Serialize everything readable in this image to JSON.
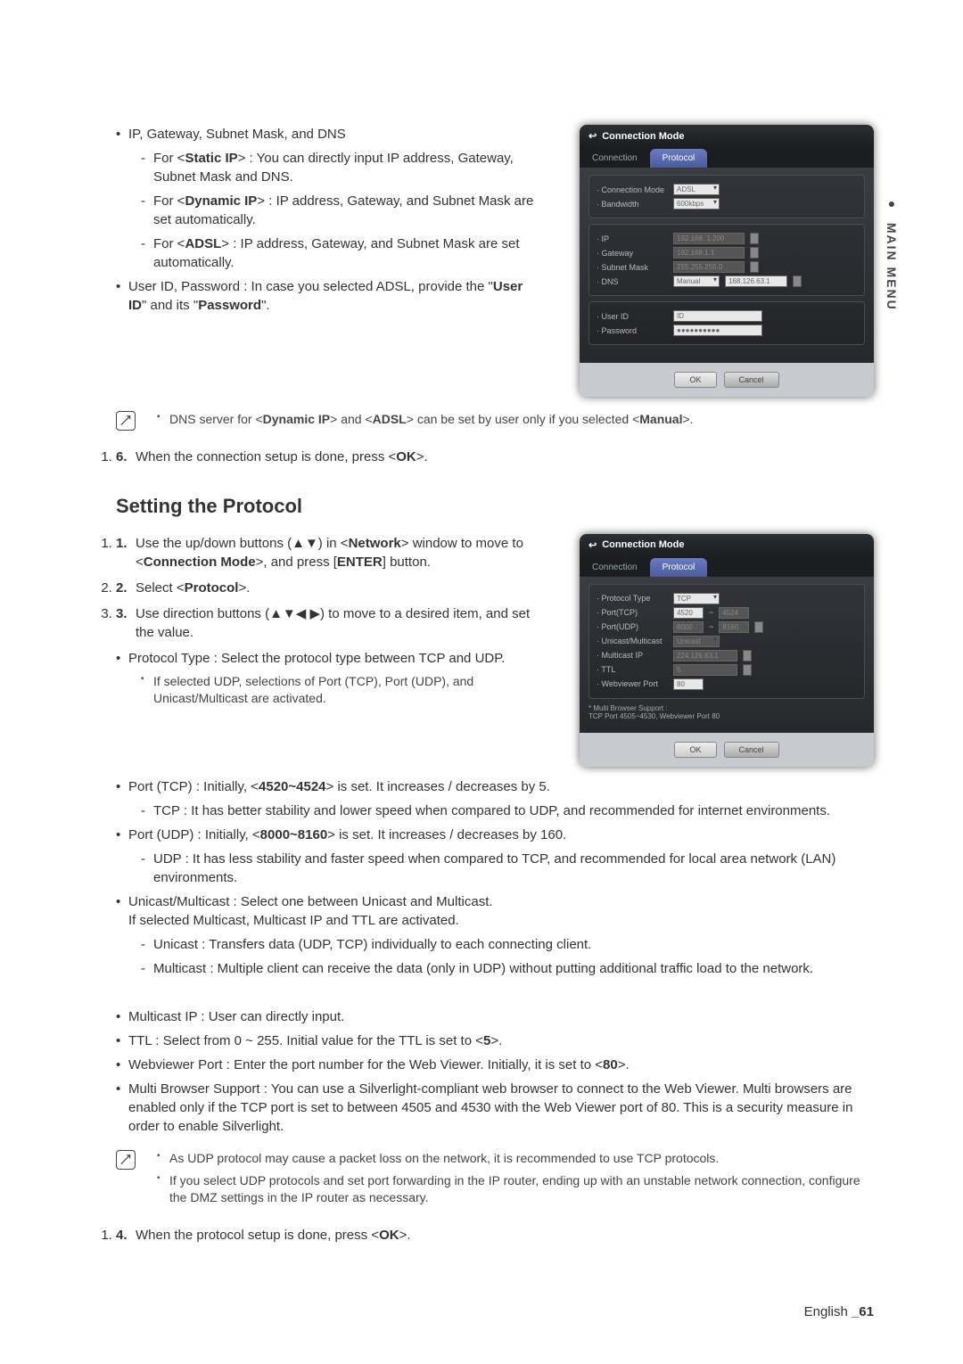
{
  "side_tab": "MAIN MENU",
  "sec1": {
    "b1": "IP, Gateway, Subnet Mask, and DNS",
    "d1": "For <Static IP> : You can directly input IP address, Gateway, Subnet Mask and DNS.",
    "d2": "For <Dynamic IP> : IP address, Gateway, and Subnet Mask are set automatically.",
    "d3": "For <ADSL> : IP address, Gateway, and Subnet Mask are set automatically.",
    "b2": "User ID, Password : In case you selected ADSL, provide the \"User ID\" and its \"Password\".",
    "note": "DNS server for <Dynamic IP> and <ADSL> can be set by user only if you selected <Manual>.",
    "step6": "When the connection setup is done, press <OK>."
  },
  "section_heading": "Setting the Protocol",
  "sec2": {
    "step1": "Use the up/down buttons (▲▼) in <Network> window to move to <Connection Mode>, and press [ENTER] button.",
    "step2": "Select <Protocol>.",
    "step3": "Use direction buttons (▲▼◀ ▶) to move to a desired item, and set the value.",
    "b_type": "Protocol Type : Select the protocol type between TCP and UDP.",
    "sq_udp": "If selected UDP, selections of Port (TCP), Port (UDP), and Unicast/Multicast are activated.",
    "b_tcp": "Port (TCP) : Initially, <4520~4524> is set. It increases / decreases by 5.",
    "d_tcp": "TCP : It has better stability and lower speed when compared to UDP, and recommended for internet environments.",
    "b_udp": "Port (UDP) : Initially, <8000~8160> is set. It increases / decreases by 160.",
    "d_udp": "UDP : It has less stability and faster speed when compared to TCP, and recommended for local area network (LAN) environments.",
    "b_uni": "Unicast/Multicast : Select one between Unicast and Multicast.\nIf selected Multicast, Multicast IP and TTL are activated.",
    "d_uni": "Unicast : Transfers data (UDP, TCP) individually to each connecting client.",
    "d_multi": "Multicast : Multiple client can receive the data (only in UDP) without putting additional traffic load to the network.",
    "b_mip": "Multicast IP : User can directly input.",
    "b_ttl": "TTL : Select from 0 ~ 255. Initial value for the TTL is set to <5>.",
    "b_web": "Webviewer Port : Enter the port number for the Web Viewer. Initially, it is set to <80>.",
    "b_multi": "Multi Browser Support : You can use a Silverlight-compliant web browser to connect to the Web Viewer. Multi browsers are enabled only if the TCP port is set to between 4505 and 4530 with the Web Viewer port of 80. This is a security measure in order to enable Silverlight.",
    "note1": "As UDP protocol may cause a packet loss on the network, it is recommended to use TCP protocols.",
    "note2": "If you select UDP protocols and set port forwarding in the IP router, ending up with an unstable network connection, configure the DMZ settings in the IP router as necessary.",
    "step4": "When the protocol setup is done, press <OK>."
  },
  "dialog1": {
    "title": "Connection Mode",
    "tab1": "Connection",
    "tab2": "Protocol",
    "cm_label": "· Connection Mode",
    "cm_val": "ADSL",
    "bw_label": "· Bandwidth",
    "bw_val": "600kbps",
    "ip_label": "· IP",
    "ip_val": "192.168. 1.200",
    "gw_label": "· Gateway",
    "gw_val": "192.168.1.1",
    "sm_label": "· Subnet Mask",
    "sm_val": "255.255.255.0",
    "dns_label": "· DNS",
    "dns_mode": "Manual",
    "dns_val": "168.126.63.1",
    "uid_label": "· User ID",
    "uid_val": "ID",
    "pw_label": "· Password",
    "pw_val": "●●●●●●●●●●",
    "ok": "OK",
    "cancel": "Cancel"
  },
  "dialog2": {
    "title": "Connection Mode",
    "tab1": "Connection",
    "tab2": "Protocol",
    "pt_label": "· Protocol Type",
    "pt_val": "TCP",
    "ptcp_label": "· Port(TCP)",
    "ptcp_v1": "4520",
    "ptcp_sep": "~",
    "ptcp_v2": "4524",
    "pudp_label": "· Port(UDP)",
    "pudp_v1": "8000",
    "pudp_v2": "8160",
    "um_label": "· Unicast/Multicast",
    "um_val": "Unicast",
    "mip_label": "· Multicast IP",
    "mip_val": "224.126.63.1",
    "ttl_label": "· TTL",
    "ttl_val": "5",
    "wp_label": "· Webviewer Port",
    "wp_val": "80",
    "foot": "* Multi Browser Support :\n   TCP Port 4505~4530, Webviewer Port 80",
    "ok": "OK",
    "cancel": "Cancel"
  },
  "footer_lang": "English",
  "footer_page": "_61"
}
